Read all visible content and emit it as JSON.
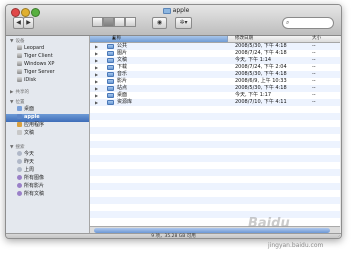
{
  "window": {
    "title": "apple"
  },
  "toolbar": {
    "back_label": "◀",
    "forward_label": "▶",
    "eye_label": "◉",
    "gear_label": "✲▾",
    "search_placeholder": ""
  },
  "sidebar": {
    "sections": [
      {
        "label": "设备"
      },
      {
        "label": "共享的"
      },
      {
        "label": "位置"
      },
      {
        "label": "搜索"
      }
    ],
    "devices": [
      "Leopard",
      "Tiger Client",
      "Windows XP",
      "Tiger Server",
      "iDisk"
    ],
    "places": [
      "桌面",
      "apple",
      "应用程序",
      "文稿"
    ],
    "search": [
      "今天",
      "昨天",
      "上周",
      "所有图像",
      "所有影片",
      "所有文稿"
    ]
  },
  "columns": {
    "name": "名称",
    "date": "修改日期",
    "size": "大小"
  },
  "rows": [
    {
      "name": "公共",
      "date": "2008/5/30, 下午 4:18"
    },
    {
      "name": "图片",
      "date": "2008/7/24, 下午 4:18"
    },
    {
      "name": "文稿",
      "date": "今天, 下午 1:14"
    },
    {
      "name": "下载",
      "date": "2008/7/24, 下午 2:04"
    },
    {
      "name": "音乐",
      "date": "2008/5/30, 下午 4:18"
    },
    {
      "name": "影片",
      "date": "2008/6/9, 上午 10:33"
    },
    {
      "name": "站点",
      "date": "2008/5/30, 下午 4:18"
    },
    {
      "name": "桌面",
      "date": "今天, 下午 1:17"
    },
    {
      "name": "资源库",
      "date": "2008/7/10, 下午 4:11"
    }
  ],
  "status": {
    "text": "9 项，35.28 GB 可用"
  },
  "watermark": {
    "brand": "Baidu",
    "url": "jingyan.baidu.com"
  },
  "colors": {
    "selection": "#3e6db8",
    "header_sort": "#6f9bd5",
    "stripe": "#edf3fe"
  }
}
